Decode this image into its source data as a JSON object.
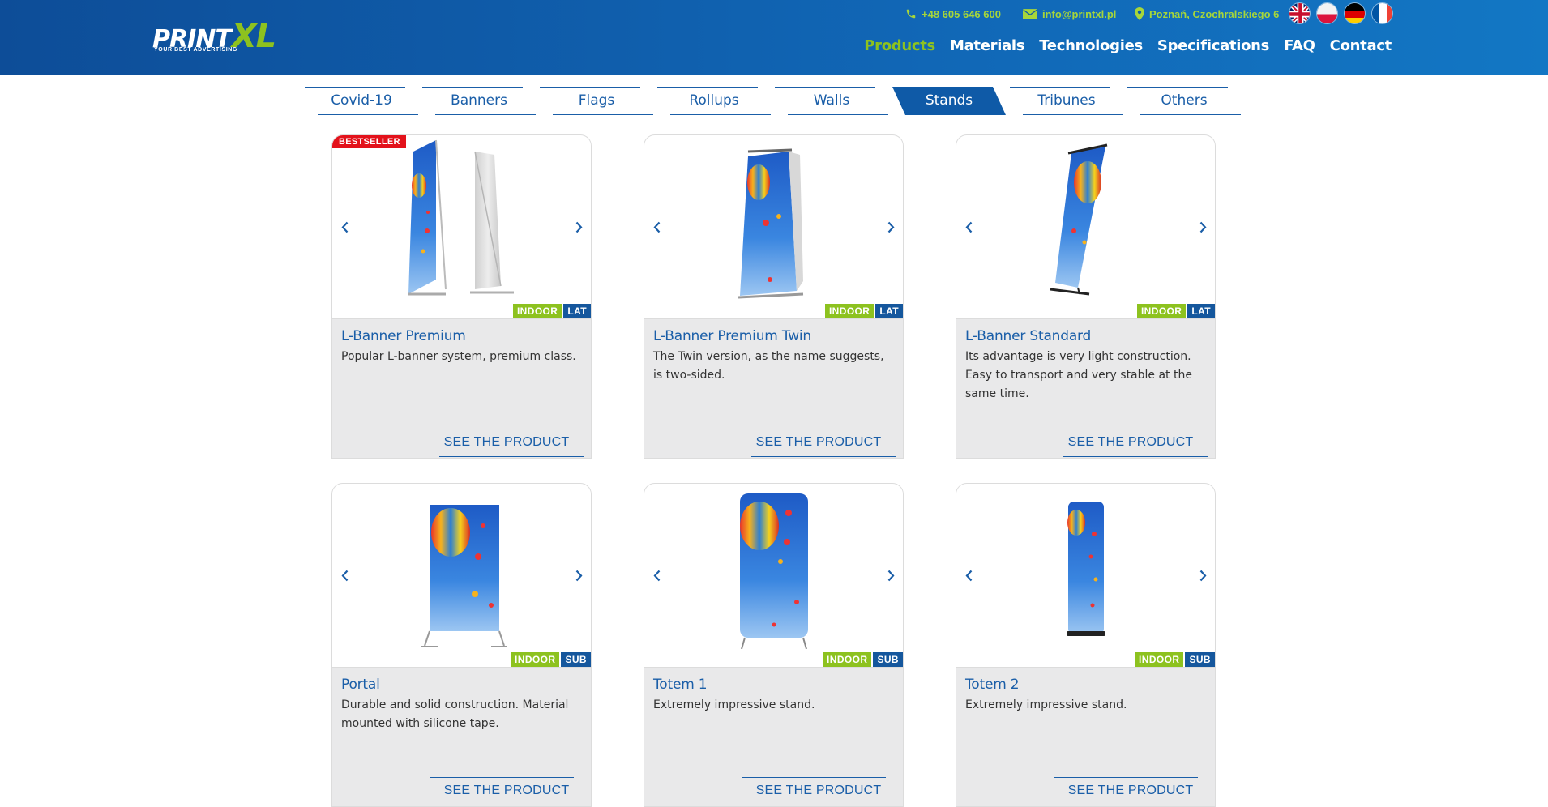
{
  "colors": {
    "header_blue": "#0d4d98",
    "accent_green": "#8dc21f",
    "brand_blue": "#1a5ea8",
    "badge_red": "#e3121b"
  },
  "logo": {
    "print": "PRINT",
    "xl": "XL",
    "tagline": "YOUR BEST ADVERTISING"
  },
  "contact": {
    "phone": "+48 605 646 600",
    "email": "info@printxl.pl",
    "address": "Poznań, Czochralskiego 6"
  },
  "languages": [
    "English",
    "Polish",
    "German",
    "French"
  ],
  "nav": [
    {
      "label": "Products",
      "active": true
    },
    {
      "label": "Materials"
    },
    {
      "label": "Technologies"
    },
    {
      "label": "Specifications"
    },
    {
      "label": "FAQ"
    },
    {
      "label": "Contact"
    }
  ],
  "categories": [
    {
      "label": "Covid-19"
    },
    {
      "label": "Banners"
    },
    {
      "label": "Flags"
    },
    {
      "label": "Rollups"
    },
    {
      "label": "Walls"
    },
    {
      "label": "Stands",
      "active": true
    },
    {
      "label": "Tribunes"
    },
    {
      "label": "Others"
    }
  ],
  "see_product_label": "SEE THE PRODUCT",
  "products": [
    {
      "name": "L-Banner Premium",
      "desc": "Popular L-banner system, premium class.",
      "badge": "BESTSELLER",
      "tag1": "INDOOR",
      "tag2": "LAT"
    },
    {
      "name": "L-Banner Premium Twin",
      "desc": "The Twin version, as the name suggests, is two-sided.",
      "tag1": "INDOOR",
      "tag2": "LAT"
    },
    {
      "name": "L-Banner Standard",
      "desc": "Its advantage is very light construction. Easy to transport and very stable at the same time.",
      "tag1": "INDOOR",
      "tag2": "LAT"
    },
    {
      "name": "Portal",
      "desc": "Durable and solid construction. Material mounted with silicone tape.",
      "tag1": "INDOOR",
      "tag2": "SUB"
    },
    {
      "name": "Totem 1",
      "desc": "Extremely impressive stand.",
      "tag1": "INDOOR",
      "tag2": "SUB"
    },
    {
      "name": "Totem 2",
      "desc": "Extremely impressive stand.",
      "tag1": "INDOOR",
      "tag2": "SUB"
    }
  ]
}
